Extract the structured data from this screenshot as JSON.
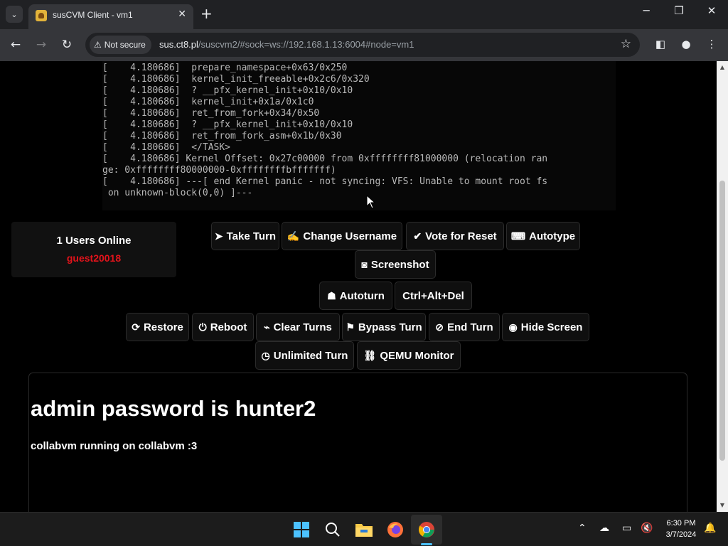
{
  "browser": {
    "tab_title": "susCVM Client - vm1",
    "tab_close": "✕",
    "new_tab": "+",
    "security_label": "Not secure",
    "url_host": "sus.ct8.pl",
    "url_path": "/suscvm2/#sock=ws://192.168.1.13:6004#node=vm1"
  },
  "console_lines": [
    "[    4.180686]  prepare_namespace+0x63/0x250",
    "[    4.180686]  kernel_init_freeable+0x2c6/0x320",
    "[    4.180686]  ? __pfx_kernel_init+0x10/0x10",
    "[    4.180686]  kernel_init+0x1a/0x1c0",
    "[    4.180686]  ret_from_fork+0x34/0x50",
    "[    4.180686]  ? __pfx_kernel_init+0x10/0x10",
    "[    4.180686]  ret_from_fork_asm+0x1b/0x30",
    "[    4.180686]  </TASK>",
    "[    4.180686] Kernel Offset: 0x27c00000 from 0xffffffff81000000 (relocation ran",
    "ge: 0xffffffff80000000-0xffffffffbfffffff)",
    "[    4.180686] ---[ end Kernel panic - not syncing: VFS: Unable to mount root fs",
    " on unknown-block(0,0) ]---"
  ],
  "users": {
    "count_label": "1 Users Online",
    "current_user": "guest20018"
  },
  "buttons": {
    "take_turn": "Take Turn",
    "change_username": "Change Username",
    "vote_reset": "Vote for Reset",
    "autotype": "Autotype",
    "screenshot": "Screenshot",
    "autoturn": "Autoturn",
    "ctrl_alt_del": "Ctrl+Alt+Del",
    "restore": "Restore",
    "reboot": "Reboot",
    "clear_turns": "Clear Turns",
    "bypass_turn": "Bypass Turn",
    "end_turn": "End Turn",
    "hide_screen": "Hide Screen",
    "unlimited_turn": "Unlimited Turn",
    "qemu_monitor": "QEMU Monitor"
  },
  "motd": {
    "heading": "admin password is hunter2",
    "text": "collabvm running on collabvm :3"
  },
  "taskbar": {
    "time": "6:30 PM",
    "date": "3/7/2024"
  },
  "colors": {
    "username_red": "#e3131b",
    "page_bg": "#000000",
    "accent_blue": "#4cc2ff"
  }
}
